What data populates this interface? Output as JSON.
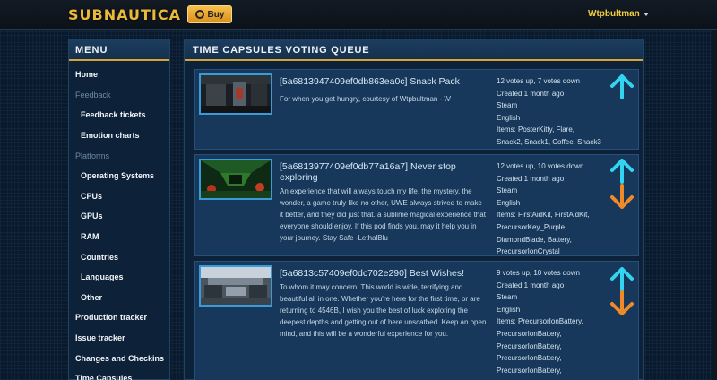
{
  "header": {
    "logo": "SUBNAUTICA",
    "buy_label": "Buy",
    "user": "Wtpbultman"
  },
  "sidebar": {
    "title": "MENU",
    "items": [
      {
        "label": "Home",
        "kind": "link"
      },
      {
        "label": "Feedback",
        "kind": "section"
      },
      {
        "label": "Feedback tickets",
        "kind": "sub"
      },
      {
        "label": "Emotion charts",
        "kind": "sub"
      },
      {
        "label": "Platforms",
        "kind": "section"
      },
      {
        "label": "Operating Systems",
        "kind": "sub"
      },
      {
        "label": "CPUs",
        "kind": "sub"
      },
      {
        "label": "GPUs",
        "kind": "sub"
      },
      {
        "label": "RAM",
        "kind": "sub"
      },
      {
        "label": "Countries",
        "kind": "sub"
      },
      {
        "label": "Languages",
        "kind": "sub"
      },
      {
        "label": "Other",
        "kind": "sub"
      },
      {
        "label": "Production tracker",
        "kind": "link"
      },
      {
        "label": "Issue tracker",
        "kind": "link"
      },
      {
        "label": "Changes and Checkins",
        "kind": "link"
      },
      {
        "label": "Time Capsules",
        "kind": "link"
      }
    ]
  },
  "main": {
    "title": "TIME CAPSULES VOTING QUEUE",
    "capsules": [
      {
        "title": "[5a6813947409ef0db863ea0c] Snack Pack",
        "description": "For when you get hungry, courtesy of Wtpbultman - \\V",
        "votes": "12 votes up, 7 votes down",
        "created": "Created 1 month ago",
        "platform": "Steam",
        "language": "English",
        "items": "Items: PosterKitty, Flare, Snack2, Snack1, Coffee, Snack3"
      },
      {
        "title": "[5a6813977409ef0db77a16a7] Never stop exploring",
        "description": "An experience that will always touch my life, the mystery, the wonder, a game truly like no other, UWE always strived to make it better, and they did just that. a sublime magical experience that everyone should enjoy. If this pod finds you, may it help you in your journey. Stay Safe -LethalBlu",
        "votes": "12 votes up, 10 votes down",
        "created": "Created 1 month ago",
        "platform": "Steam",
        "language": "English",
        "items": "Items: FirstAidKit, FirstAidKit, PrecursorKey_Purple, DiamondBlade, Battery, PrecursorIonCrystal"
      },
      {
        "title": "[5a6813c57409ef0dc702e290] Best Wishes!",
        "description": "To whom it may concern, This world is wide, terrifying and beautiful all in one. Whether you're here for the first time, or are returning to 4546B, I wish you the best of luck exploring the deepest depths and getting out of here unscathed. Keep an open mind, and this will be a wonderful experience for you.",
        "votes": "9 votes up, 10 votes down",
        "created": "Created 1 month ago",
        "platform": "Steam",
        "language": "English",
        "items": "Items: PrecursorIonBattery, PrecursorIonBattery, PrecursorIonBattery, PrecursorIonBattery, PrecursorIonBattery,"
      }
    ]
  },
  "colors": {
    "accent": "#d6a43a",
    "vote_up": "#34d4f0",
    "vote_down": "#f08a28"
  }
}
